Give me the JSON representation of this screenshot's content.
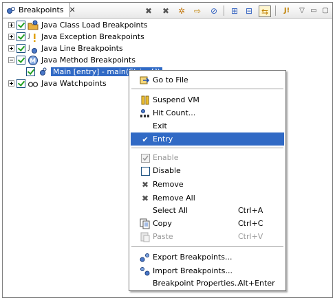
{
  "view": {
    "tab_label": "Breakpoints",
    "tab_close": "✕",
    "toolbar": [
      {
        "name": "remove-breakpoint-icon",
        "glyph": "✖",
        "color": "#555555"
      },
      {
        "name": "remove-all-breakpoints-icon",
        "glyph": "✖",
        "color": "#555555"
      },
      {
        "name": "show-breakpoints-supported-icon",
        "glyph": "✲",
        "color": "#c07000"
      },
      {
        "name": "go-to-file-icon",
        "glyph": "⇨",
        "color": "#c08000"
      },
      {
        "name": "skip-all-breakpoints-icon",
        "glyph": "⊘",
        "color": "#3060c0"
      },
      {
        "name": "expand-all-icon",
        "glyph": "⊞",
        "color": "#3060c0"
      },
      {
        "name": "collapse-all-icon",
        "glyph": "⊟",
        "color": "#3060c0"
      },
      {
        "name": "link-with-debug-view-icon",
        "glyph": "⇆",
        "color": "#c08000"
      },
      {
        "name": "add-java-exception-breakpoint-icon",
        "glyph": "J!",
        "color": "#c08000"
      },
      {
        "name": "view-menu-icon",
        "glyph": "▽",
        "color": "#444444"
      },
      {
        "name": "minimize-icon",
        "glyph": "▭",
        "color": "#444444"
      },
      {
        "name": "maximize-icon",
        "glyph": "▢",
        "color": "#444444"
      }
    ]
  },
  "tree": {
    "items": [
      {
        "label": "Java Class Load Breakpoints",
        "expander": "plus",
        "icon": "class-load-icon"
      },
      {
        "label": "Java Exception Breakpoints",
        "expander": "plus",
        "icon": "exception-icon"
      },
      {
        "label": "Java Line Breakpoints",
        "expander": "plus",
        "icon": "line-icon"
      },
      {
        "label": "Java Method Breakpoints",
        "expander": "minus",
        "icon": "method-icon"
      },
      {
        "label": "Main [entry] - main(String[])",
        "child": true,
        "selected": true,
        "icon": "method-breakpoint-icon"
      },
      {
        "label": "Java Watchpoints",
        "expander": "plus",
        "icon": "watchpoint-icon"
      }
    ]
  },
  "menu": {
    "items": [
      {
        "label": "Go to File",
        "icon": "go-to-file-icon"
      },
      {
        "label": "Suspend VM",
        "icon": "suspend-vm-icon"
      },
      {
        "label": "Hit Count...",
        "icon": "hit-count-icon"
      },
      {
        "label": "Exit"
      },
      {
        "label": "Entry",
        "checked": true,
        "highlighted": true
      },
      {
        "label": "Enable",
        "disabled": true,
        "icon": "enable-checkbox-icon"
      },
      {
        "label": "Disable",
        "icon": "disable-checkbox-icon"
      },
      {
        "label": "Remove",
        "icon": "remove-icon"
      },
      {
        "label": "Remove All",
        "icon": "remove-all-icon"
      },
      {
        "label": "Select All",
        "accel": "Ctrl+A"
      },
      {
        "label": "Copy",
        "accel": "Ctrl+C",
        "icon": "copy-icon"
      },
      {
        "label": "Paste",
        "accel": "Ctrl+V",
        "disabled": true,
        "icon": "paste-icon"
      },
      {
        "label": "Export Breakpoints...",
        "icon": "export-icon"
      },
      {
        "label": "Import Breakpoints...",
        "icon": "import-icon"
      },
      {
        "label": "Breakpoint Properties...",
        "accel": "Alt+Enter"
      }
    ],
    "check_glyph": "✔"
  },
  "colors": {
    "selection": "#316ac5",
    "check_green": "#21a121"
  }
}
